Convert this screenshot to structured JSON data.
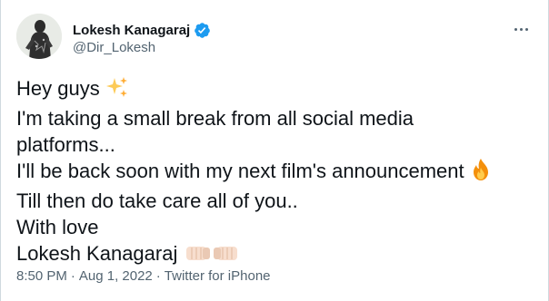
{
  "author": {
    "display_name": "Lokesh Kanagaraj",
    "handle": "@Dir_Lokesh",
    "verified": true
  },
  "tweet": {
    "lines": [
      {
        "text": "Hey guys",
        "emoji": "sparkles-icon"
      },
      {
        "text": "I'm taking a small break from all social media"
      },
      {
        "text": "platforms..."
      },
      {
        "text": "I'll be back soon with my next film's announcement",
        "emoji": "fire-icon"
      },
      {
        "text": "Till then do take care all of you.."
      },
      {
        "text": "With love"
      },
      {
        "text": "Lokesh Kanagaraj",
        "emoji": "fist-bump-icon"
      }
    ]
  },
  "meta": {
    "time": "8:50 PM",
    "date": "Aug 1, 2022",
    "source": "Twitter for iPhone",
    "separator": "·"
  },
  "colors": {
    "text_primary": "#0f1419",
    "text_secondary": "#536471",
    "verified_blue": "#1d9bf0",
    "border": "#cfd9de"
  }
}
